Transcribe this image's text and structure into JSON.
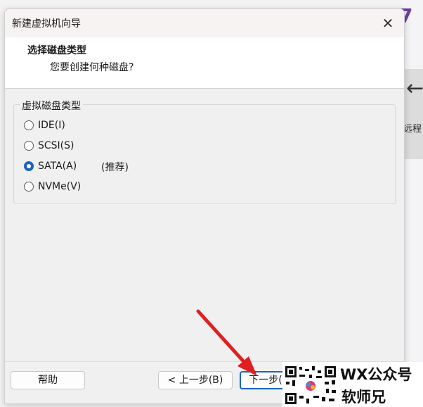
{
  "background_app": {
    "accent_text": "7",
    "partial_label": "远程",
    "arrow_icon": "arrow-left-icon"
  },
  "dialog": {
    "title": "新建虚拟机向导",
    "close_icon": "close-icon",
    "header": {
      "title": "选择磁盘类型",
      "subtitle": "您要创建何种磁盘?"
    },
    "group_label": "虚拟磁盘类型",
    "options": [
      {
        "label": "IDE(I)",
        "checked": false
      },
      {
        "label": "SCSI(S)",
        "checked": false
      },
      {
        "label": "SATA(A)",
        "checked": true,
        "note": "(推荐)"
      },
      {
        "label": "NVMe(V)",
        "checked": false
      }
    ],
    "buttons": {
      "help": "帮助",
      "back": "< 上一步(B)",
      "next": "下一步(N) >"
    }
  },
  "watermark": {
    "line1": "WX公众号",
    "line2": "软师兄"
  },
  "colors": {
    "accent_purple": "#6b3fa0",
    "radio_selected": "#1a63c4",
    "annotation_arrow": "#e02020"
  }
}
